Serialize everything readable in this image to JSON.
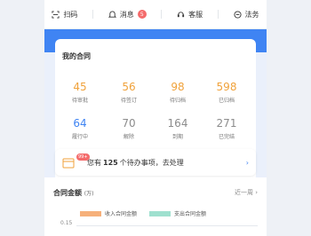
{
  "topbar": {
    "scan": "扫码",
    "message": "消息",
    "message_count": "5",
    "service": "客服",
    "law": "法务"
  },
  "contract": {
    "title": "我的合同",
    "row1": [
      {
        "value": "45",
        "label": "待审批",
        "color": "#f0a23b"
      },
      {
        "value": "56",
        "label": "待签订",
        "color": "#f0a23b"
      },
      {
        "value": "98",
        "label": "待归档",
        "color": "#f0a23b"
      },
      {
        "value": "598",
        "label": "已归档",
        "color": "#f0a23b"
      }
    ],
    "row2": [
      {
        "value": "64",
        "label": "履行中",
        "color": "#3f84f3"
      },
      {
        "value": "70",
        "label": "解除",
        "color": "#8c8c8c"
      },
      {
        "value": "164",
        "label": "到期",
        "color": "#8c8c8c"
      },
      {
        "value": "271",
        "label": "已完结",
        "color": "#8c8c8c"
      }
    ]
  },
  "todo": {
    "text_pre": "您有",
    "count": "125",
    "text_post": "个待办事项，去处理",
    "badge": "99+"
  },
  "amount": {
    "title": "合同金额",
    "unit": "(万)",
    "range": "近一周",
    "legend_in": "收入合同金额",
    "legend_out": "支出合同金额",
    "y_tick": "0.15"
  },
  "colors": {
    "accent": "#3f84f3",
    "income": "#f6b07a",
    "expense": "#9fe0cf"
  }
}
